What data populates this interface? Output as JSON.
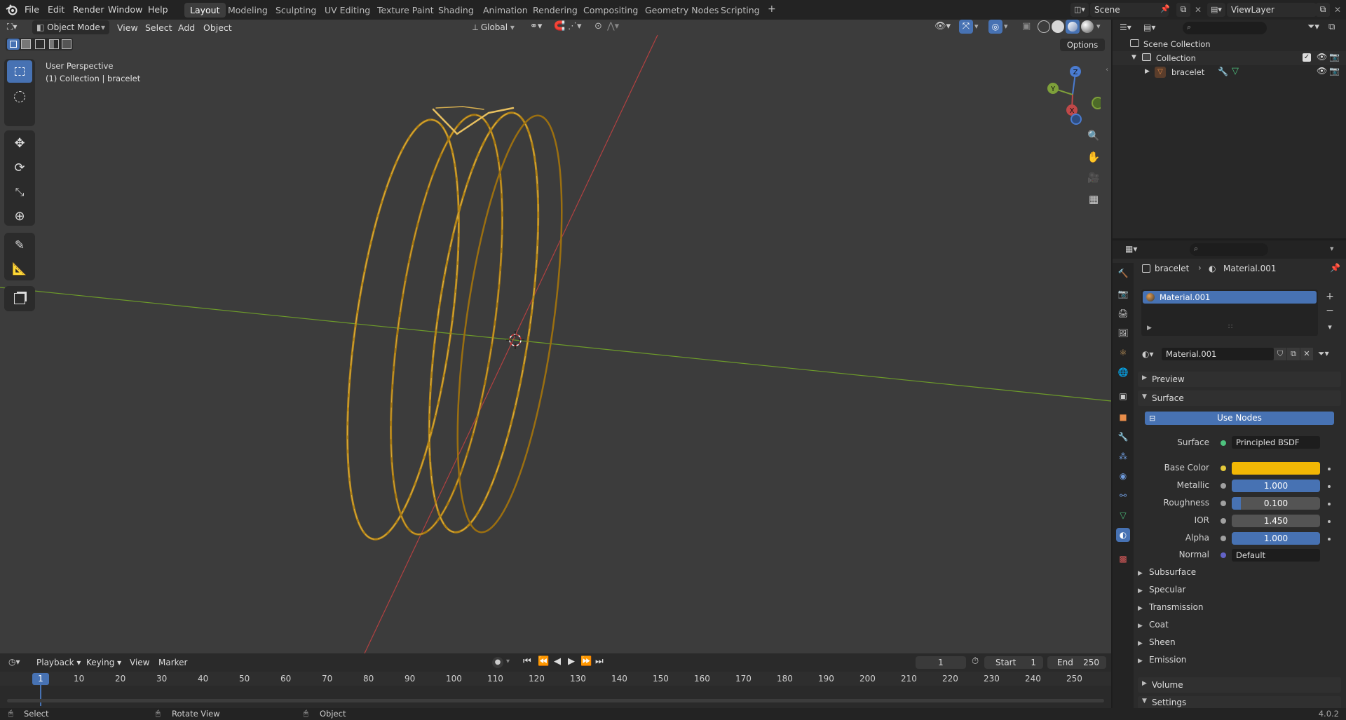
{
  "topbar": {
    "menus": [
      "File",
      "Edit",
      "Render",
      "Window",
      "Help"
    ],
    "workspaces": [
      "Layout",
      "Modeling",
      "Sculpting",
      "UV Editing",
      "Texture Paint",
      "Shading",
      "Animation",
      "Rendering",
      "Compositing",
      "Geometry Nodes",
      "Scripting"
    ],
    "add_tab": "+",
    "scene": "Scene",
    "view_layer": "ViewLayer"
  },
  "viewport": {
    "mode": "Object Mode",
    "menus": [
      "View",
      "Select",
      "Add",
      "Object"
    ],
    "orientation": "Global",
    "options": "Options",
    "perspective": "User Perspective",
    "context": "(1) Collection | bracelet",
    "gizmo": {
      "x": "X",
      "y": "Y",
      "z": "Z"
    }
  },
  "outliner": {
    "search_placeholder": "",
    "scene_collection": "Scene Collection",
    "collection": "Collection",
    "object": "bracelet"
  },
  "properties": {
    "breadcrumb": {
      "object": "bracelet",
      "material": "Material.001"
    },
    "slot": "Material.001",
    "material_name": "Material.001",
    "panels": {
      "preview": "Preview",
      "surface": "Surface",
      "use_nodes": "Use Nodes"
    },
    "surface": {
      "surface_label": "Surface",
      "surface_value": "Principled BSDF",
      "base_color_label": "Base Color",
      "base_color": "#f2b705",
      "metallic_label": "Metallic",
      "metallic": "1.000",
      "metallic_fraction": 1.0,
      "roughness_label": "Roughness",
      "roughness": "0.100",
      "roughness_fraction": 0.1,
      "ior_label": "IOR",
      "ior": "1.450",
      "alpha_label": "Alpha",
      "alpha": "1.000",
      "alpha_fraction": 1.0,
      "normal_label": "Normal",
      "normal": "Default"
    },
    "subpanels": [
      "Subsurface",
      "Specular",
      "Transmission",
      "Coat",
      "Sheen",
      "Emission"
    ],
    "volume": "Volume",
    "settings": "Settings"
  },
  "timeline": {
    "menus": [
      "Playback",
      "Keying",
      "View",
      "Marker"
    ],
    "current_frame": "1",
    "start_label": "Start",
    "start": "1",
    "end_label": "End",
    "end": "250",
    "ruler": [
      "1",
      "10",
      "20",
      "30",
      "40",
      "50",
      "60",
      "70",
      "80",
      "90",
      "100",
      "110",
      "120",
      "130",
      "140",
      "150",
      "160",
      "170",
      "180",
      "190",
      "200",
      "210",
      "220",
      "230",
      "240",
      "250"
    ]
  },
  "statusbar": {
    "select": "Select",
    "rotate": "Rotate View",
    "object": "Object",
    "version": "4.0.2"
  },
  "colors": {
    "accent": "#4772b3",
    "gold": "#c9951c",
    "x_axis": "#b34141",
    "y_axis": "#6d9b2a"
  }
}
